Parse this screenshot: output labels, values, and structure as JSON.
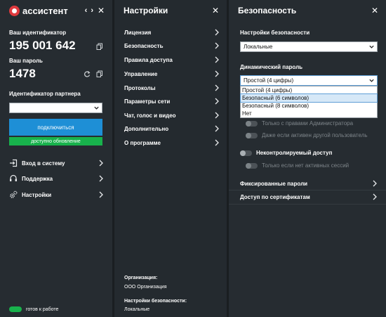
{
  "app": {
    "name": "ассистент",
    "your_id_label": "Ваш идентификатор",
    "your_id": "195 001 642",
    "password_label": "Ваш пароль",
    "password": "1478",
    "partner_label": "Идентификатор партнера",
    "partner_value": "",
    "connect_button": "подключиться",
    "update_button": "доступно обновление",
    "menu": [
      {
        "label": "Вход в систему",
        "icon": "login-icon"
      },
      {
        "label": "Поддержка",
        "icon": "headset-icon"
      },
      {
        "label": "Настройки",
        "icon": "gears-icon"
      }
    ],
    "status": "готов к работе"
  },
  "settings": {
    "title": "Настройки",
    "items": [
      "Лицензия",
      "Безопасность",
      "Правила доступа",
      "Управление",
      "Протоколы",
      "Параметры сети",
      "Чат, голос и видео",
      "Дополнительно",
      "О программе"
    ],
    "org_label": "Организация:",
    "org_value": "ООО Организация",
    "sec_label": "Настройки безопасности:",
    "sec_value": "Локальные"
  },
  "security": {
    "title": "Безопасность",
    "settings_label": "Настройки безопасности",
    "settings_value": "Локальные",
    "dynamic_label": "Динамический пароль",
    "dynamic_value": "Простой (4 цифры)",
    "dynamic_options": [
      "Простой (4 цифры)",
      "Безопасный (6 символов)",
      "Безопасный (8 символов)",
      "Нет"
    ],
    "admin_only": "Только с правами Администратора",
    "even_if_active": "Даже если активен другой пользователь",
    "uncontrolled": "Неконтролируемый доступ",
    "only_no_sessions": "Только если нет активных сессий",
    "fixed_passwords": "Фиксированные пароли",
    "cert_access": "Доступ по сертификатам"
  },
  "colors": {
    "accent_blue": "#1e8fd6",
    "accent_green": "#18b24c",
    "brand_red": "#e03a3e"
  }
}
